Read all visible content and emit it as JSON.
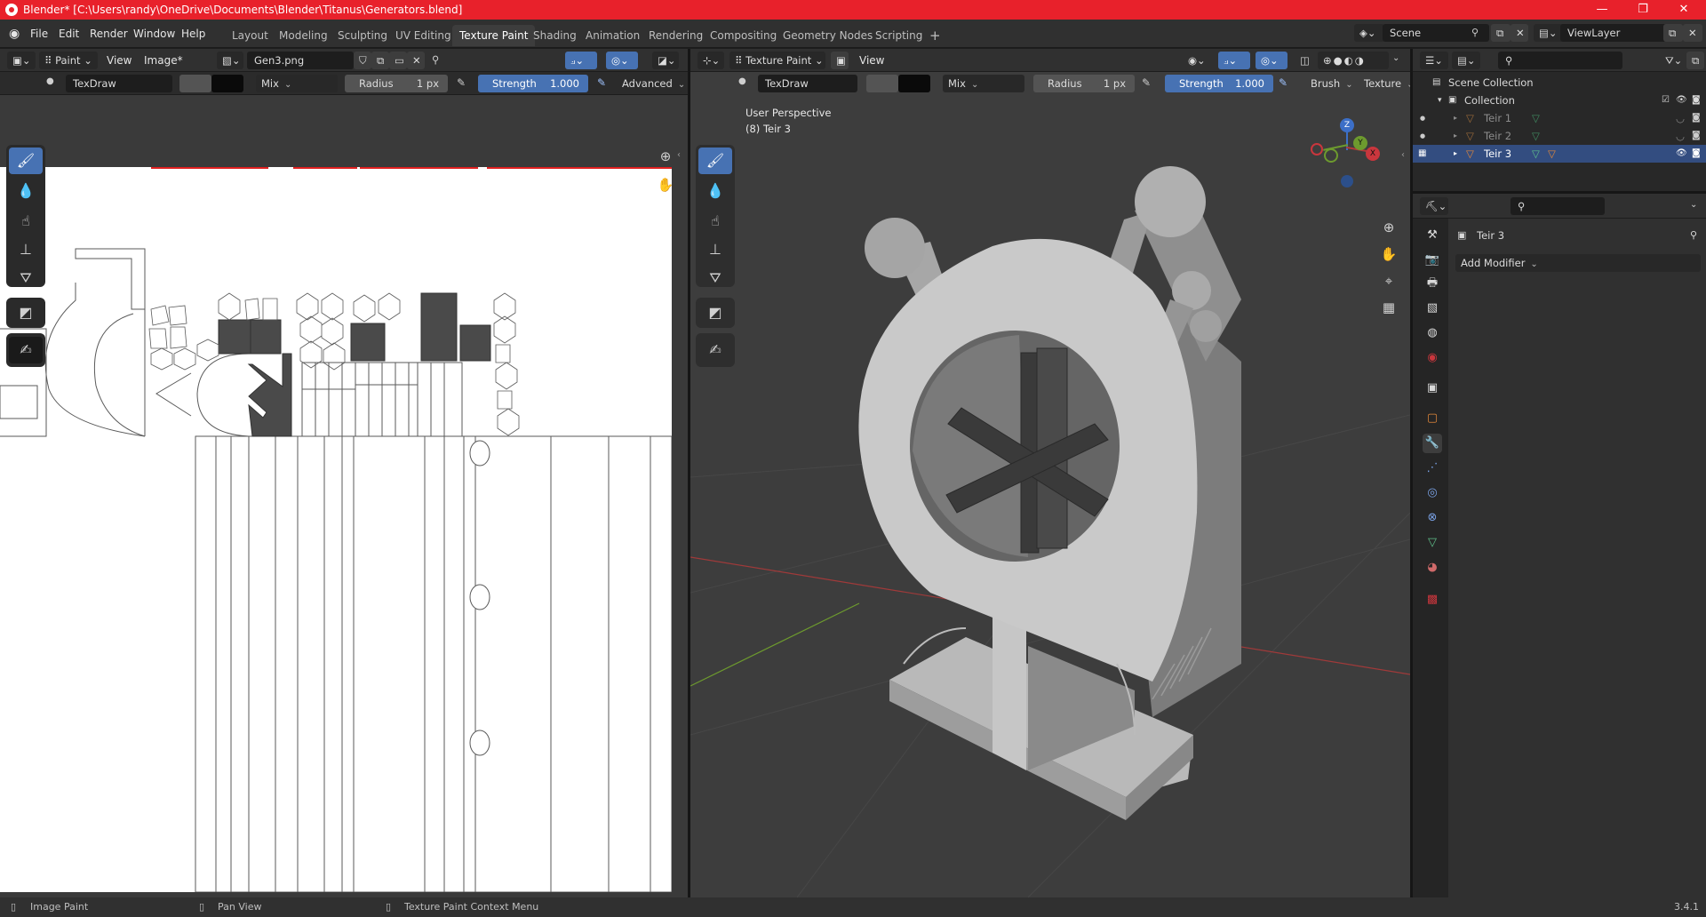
{
  "window": {
    "title": "Blender* [C:\\Users\\randy\\OneDrive\\Documents\\Blender\\Titanus\\Generators.blend]",
    "minimize": "—",
    "maximize": "❐",
    "close": "✕"
  },
  "menu": [
    "File",
    "Edit",
    "Render",
    "Window",
    "Help"
  ],
  "workspaces": [
    "Layout",
    "Modeling",
    "Sculpting",
    "UV Editing",
    "Texture Paint",
    "Shading",
    "Animation",
    "Rendering",
    "Compositing",
    "Geometry Nodes",
    "Scripting"
  ],
  "active_workspace": "Texture Paint",
  "add_workspace": "+",
  "scene": {
    "label": "Scene"
  },
  "view_layer": {
    "label": "ViewLayer"
  },
  "image_editor": {
    "mode": "Paint",
    "view_menu": "View",
    "image_menu": "Image*",
    "image_name": "Gen3.png",
    "brush_name": "TexDraw",
    "blend_mode": "Mix",
    "radius_label": "Radius",
    "radius_value": "1 px",
    "strength_label": "Strength",
    "strength_value": "1.000",
    "advanced": "Advanced"
  },
  "viewport": {
    "mode": "Texture Paint",
    "view_menu": "View",
    "brush_name": "TexDraw",
    "blend_mode": "Mix",
    "radius_label": "Radius",
    "radius_value": "1 px",
    "strength_label": "Strength",
    "strength_value": "1.000",
    "brush_menu": "Brush",
    "texture_menu": "Texture",
    "perspective_label": "User Perspective",
    "object_label": "(8) Teir 3",
    "gizmo": {
      "x": "X",
      "y": "Y",
      "z": "Z"
    }
  },
  "outliner": {
    "scene_collection": "Scene Collection",
    "collection": "Collection",
    "items": [
      {
        "label": "Teir 1",
        "selected": false
      },
      {
        "label": "Teir 2",
        "selected": false
      },
      {
        "label": "Teir 3",
        "selected": true
      }
    ]
  },
  "properties": {
    "object_name": "Teir 3",
    "add_modifier": "Add Modifier"
  },
  "status_bar": {
    "left": "Image Paint",
    "middle": "Pan View",
    "right": "Texture Paint Context Menu",
    "version": "3.4.1"
  },
  "colors": {
    "titlebar": "#e8212b",
    "accent": "#4772b3",
    "selection": "#334d80",
    "object_orange": "#e0873a",
    "mesh_green": "#5fbf8a"
  }
}
